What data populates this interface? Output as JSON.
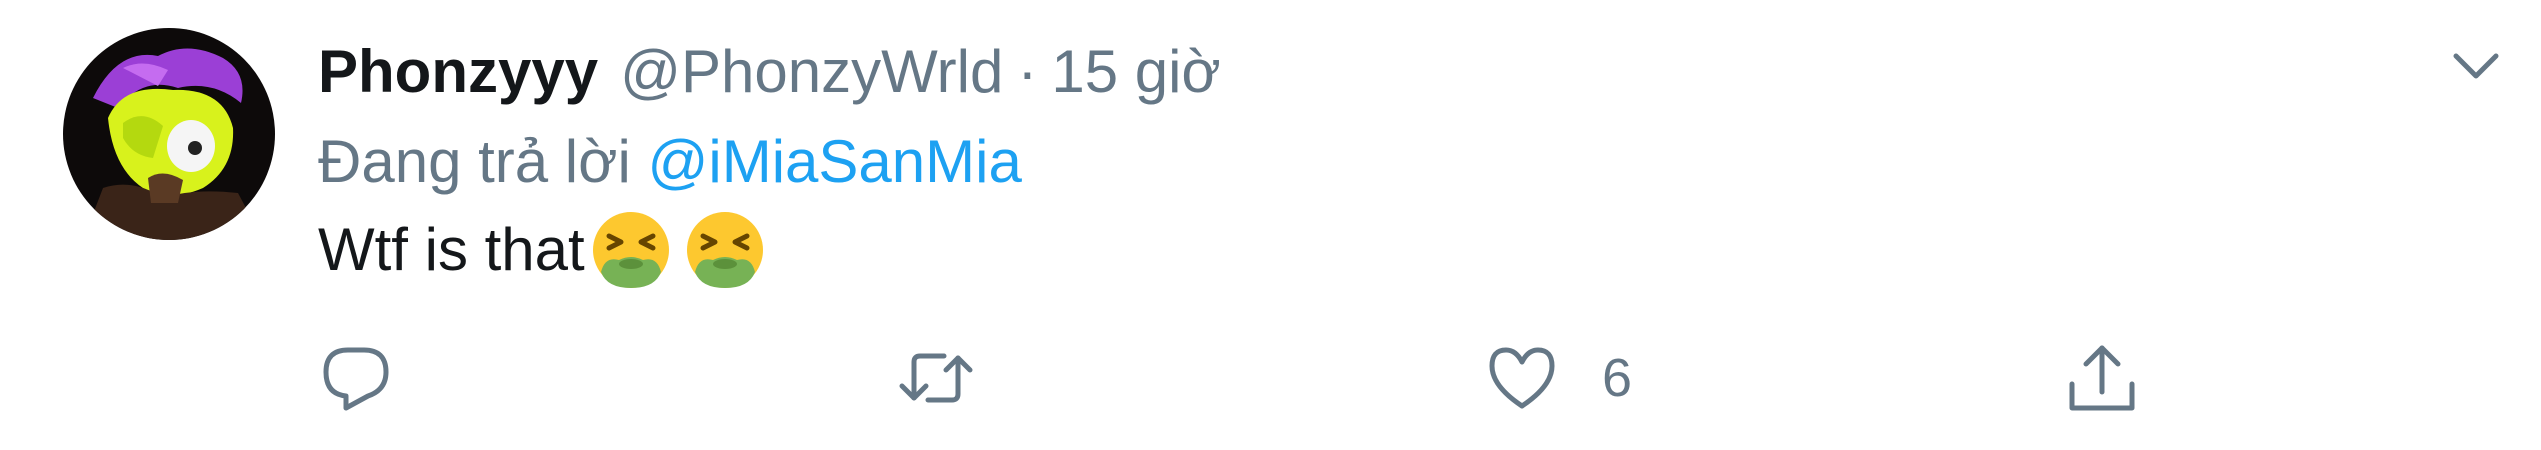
{
  "tweet": {
    "display_name": "Phonzyyy",
    "handle": "@PhonzyWrld",
    "separator": "·",
    "time": "15 giờ",
    "reply_prefix": "Đang trả lời",
    "reply_to": "@iMiaSanMia",
    "text": "Wtf is that",
    "emojis": [
      "vomiting-face-emoji",
      "vomiting-face-emoji"
    ]
  },
  "actions": {
    "reply_icon": "reply-icon",
    "retweet_icon": "retweet-icon",
    "like_icon": "heart-icon",
    "like_count": "6",
    "share_icon": "share-icon"
  },
  "menu": {
    "caret_icon": "chevron-down-icon"
  },
  "colors": {
    "text_primary": "#14171a",
    "text_secondary": "#657786",
    "link": "#1da1f2",
    "icon": "#657786"
  }
}
